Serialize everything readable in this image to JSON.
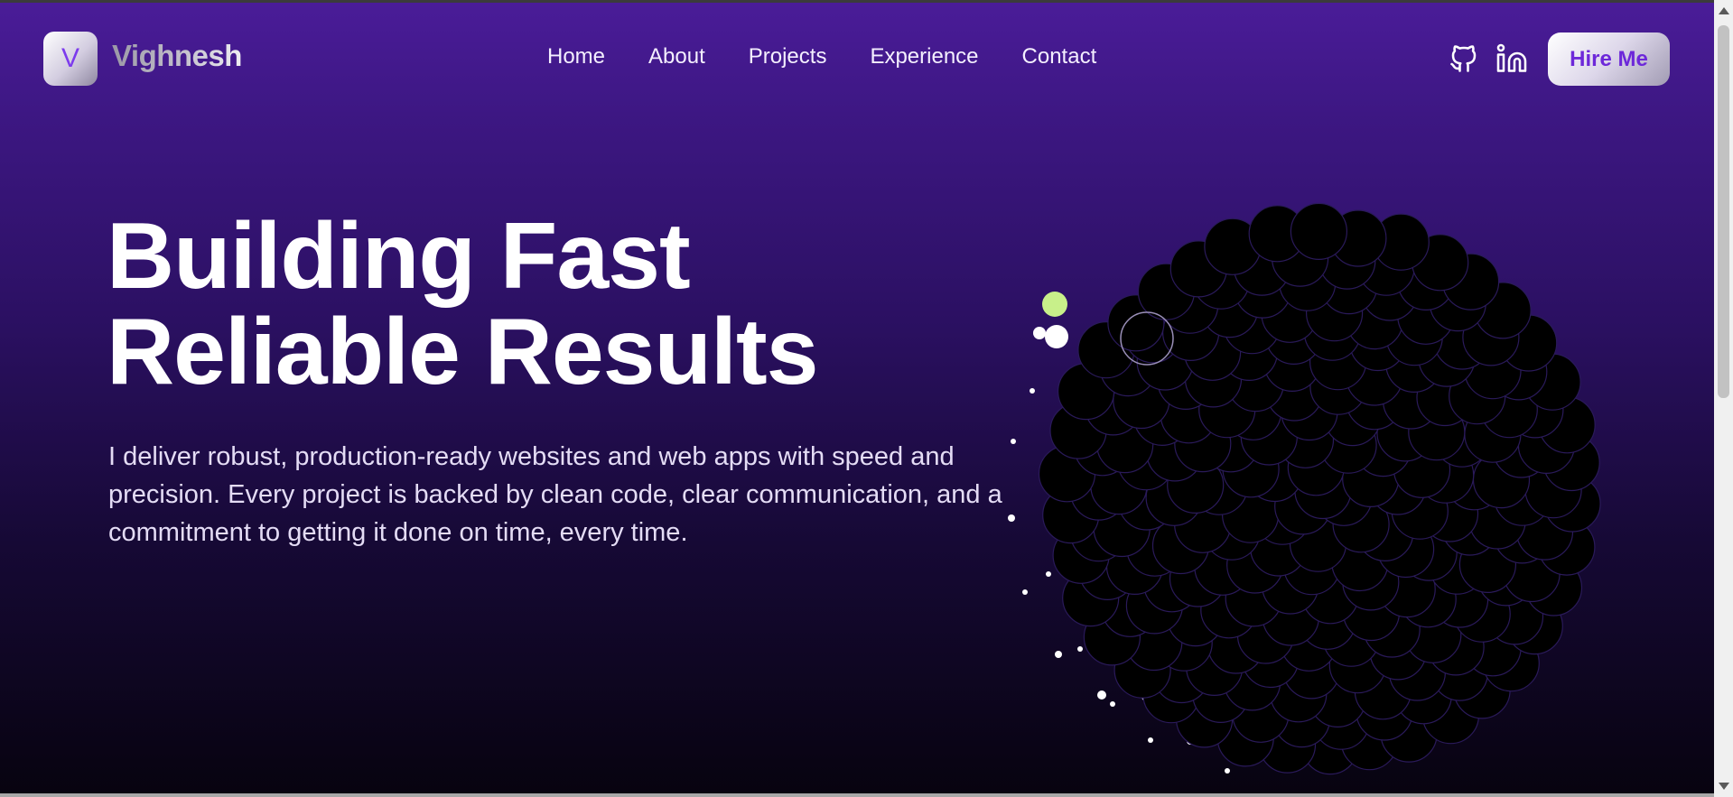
{
  "header": {
    "logo_letter": "V",
    "brand_name": "Vighnesh",
    "nav_items": [
      "Home",
      "About",
      "Projects",
      "Experience",
      "Contact"
    ],
    "social_icons": [
      "github-icon",
      "linkedin-icon"
    ],
    "cta_label": "Hire Me"
  },
  "hero": {
    "title_line1": "Building Fast",
    "title_line2": "Reliable Results",
    "description": "I deliver robust, production-ready websites and web apps with speed and precision. Every project is backed by clean code, clear communication, and a commitment to getting it done on time, every time."
  },
  "colors": {
    "accent": "#7c3aed",
    "bg_top": "#4a1c98",
    "bg_bottom": "#07030f",
    "orb_glow": "#5b2cff"
  }
}
